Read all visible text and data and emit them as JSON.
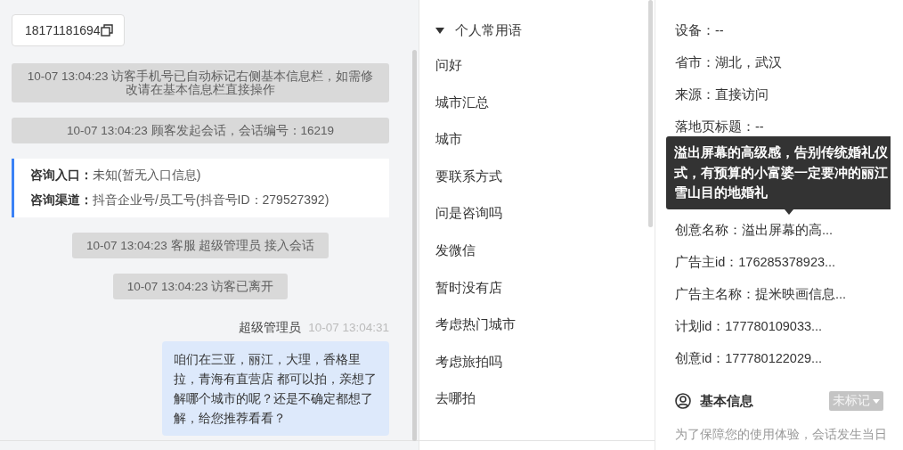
{
  "chat": {
    "phone": "18171181694",
    "events": [
      {
        "kind": "system",
        "text": "10-07 13:04:23 访客手机号已自动标记右侧基本信息栏，如需修改请在基本信息栏直接操作"
      },
      {
        "kind": "system",
        "text": "10-07 13:04:23 顾客发起会话，会话编号：16219"
      },
      {
        "kind": "card",
        "rows": [
          {
            "label": "咨询入口：",
            "value": "未知(暂无入口信息)"
          },
          {
            "label": "咨询渠道：",
            "value": "抖音企业号/员工号(抖音号ID：279527392)"
          }
        ]
      },
      {
        "kind": "system",
        "text": "10-07 13:04:23 客服 超级管理员 接入会话"
      },
      {
        "kind": "system",
        "text": "10-07 13:04:23 访客已离开"
      },
      {
        "kind": "message",
        "sender": "超级管理员",
        "time": "10-07 13:04:31",
        "text": "咱们在三亚，丽江，大理，香格里拉，青海有直营店 都可以拍，亲想了解哪个城市的呢？还是不确定都想了解，给您推荐看看？"
      }
    ]
  },
  "phrases": {
    "group": "个人常用语",
    "expanded": true,
    "items": [
      "问好",
      "城市汇总",
      "城市",
      "要联系方式",
      "问是咨询吗",
      "发微信",
      "暂时没有店",
      "考虑热门城市",
      "考虑旅拍吗",
      "去哪拍"
    ]
  },
  "visitor_info": {
    "fields": [
      {
        "text": "设备：--"
      },
      {
        "text": "省市：湖北，武汉"
      },
      {
        "text": "来源：直接访问"
      },
      {
        "text": "落地页标题：--"
      },
      {
        "text": "创意名称：溢出屏幕的高..."
      },
      {
        "text": "广告主id：176285378923..."
      },
      {
        "text": "广告主名称：提米映画信息..."
      },
      {
        "text": "计划id：177780109033..."
      },
      {
        "text": "创意id：177780122029..."
      }
    ],
    "tooltip": "溢出屏幕的高级感，告别传统婚礼仪式，有预算的小富婆一定要冲的丽江雪山目的地婚礼"
  },
  "basic_info": {
    "title": "基本信息",
    "tag": "未标记",
    "notice": "为了保障您的使用体验，会话发生当日"
  }
}
